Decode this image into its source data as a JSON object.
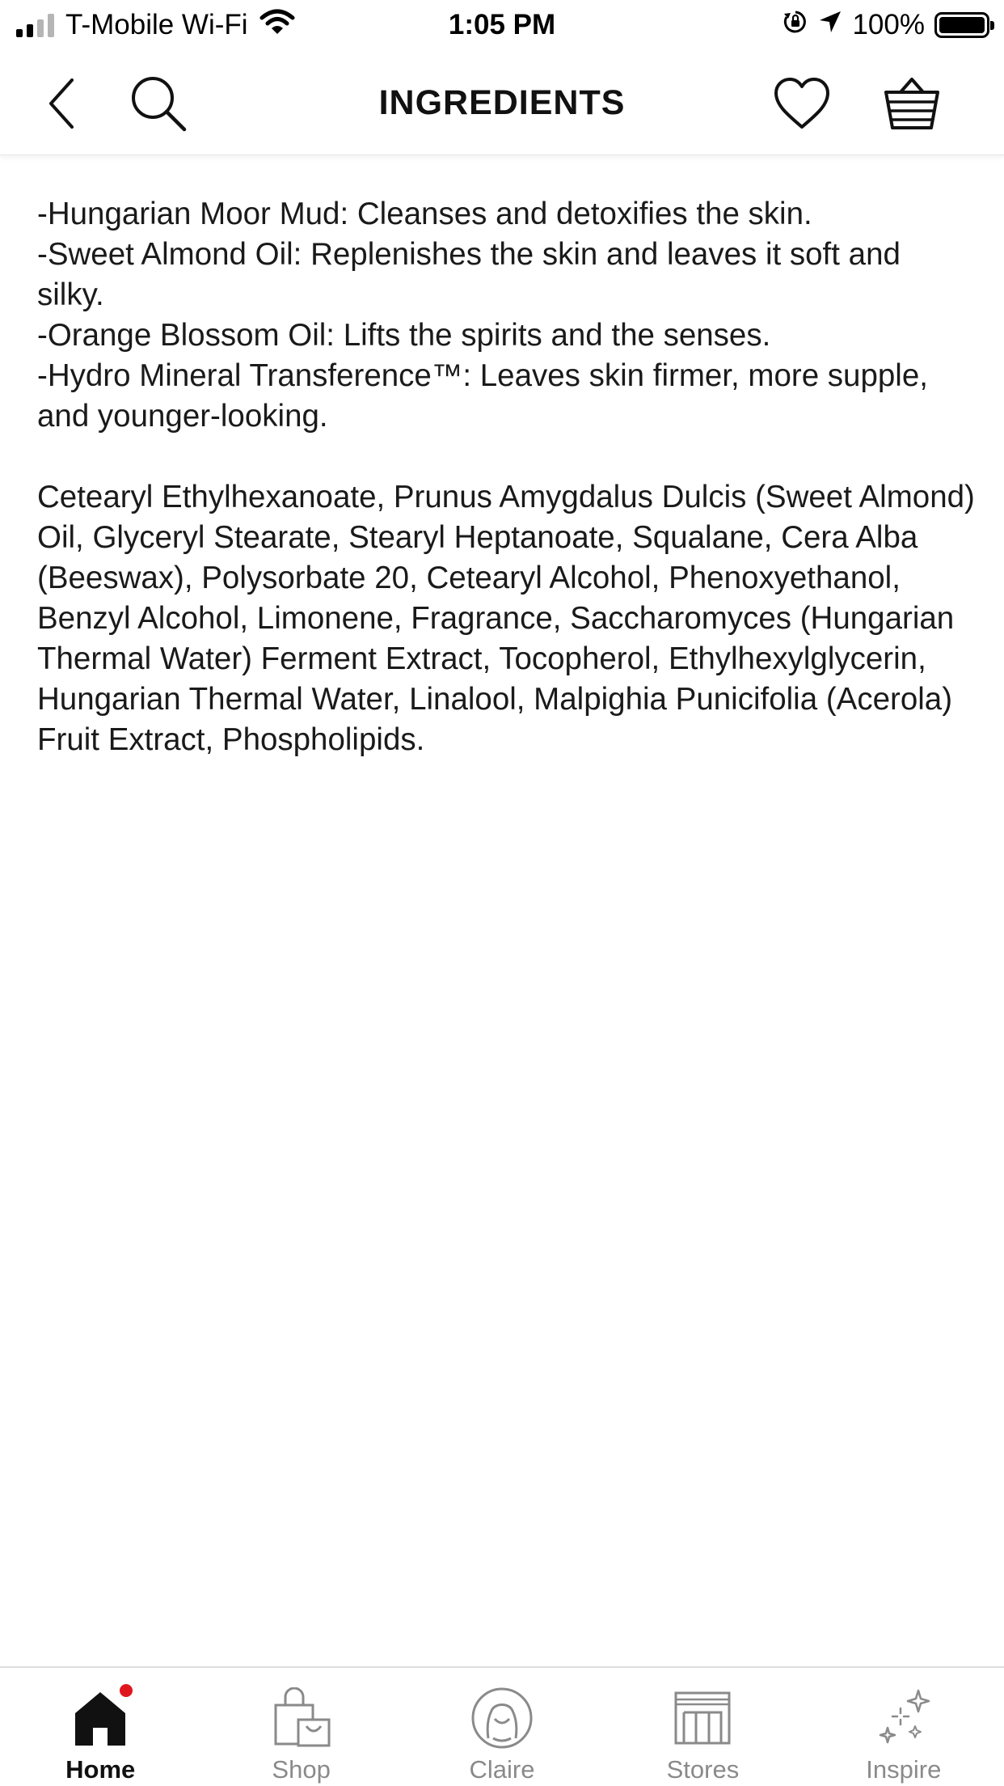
{
  "status_bar": {
    "carrier": "T-Mobile Wi-Fi",
    "time": "1:05 PM",
    "battery": "100%",
    "icons": [
      "signal-icon",
      "wifi-icon",
      "orientation-lock-icon",
      "location-arrow-icon",
      "battery-icon"
    ]
  },
  "header": {
    "title": "INGREDIENTS",
    "icons": [
      "back-chevron-icon",
      "search-icon",
      "heart-icon",
      "basket-icon"
    ]
  },
  "content": {
    "benefits": [
      "-Hungarian Moor Mud: Cleanses and detoxifies the skin.",
      "-Sweet Almond Oil: Replenishes the skin and leaves it soft and silky.",
      "-Orange Blossom Oil: Lifts the spirits and the senses.",
      "-Hydro Mineral Transference™: Leaves skin firmer, more supple, and younger-looking."
    ],
    "ingredient_list": "Cetearyl Ethylhexanoate, Prunus Amygdalus Dulcis (Sweet Almond) Oil, Glyceryl Stearate, Stearyl Heptanoate, Squalane, Cera Alba (Beeswax), Polysorbate 20, Cetearyl Alcohol, Phenoxyethanol, Benzyl Alcohol, Limonene, Fragrance, Saccharomyces (Hungarian Thermal Water) Ferment Extract, Tocopherol, Ethylhexylglycerin, Hungarian Thermal Water, Linalool, Malpighia Punicifolia (Acerola) Fruit Extract, Phospholipids."
  },
  "tab_bar": {
    "items": [
      {
        "label": "Home",
        "icon": "home-icon",
        "active": true,
        "has_badge": true
      },
      {
        "label": "Shop",
        "icon": "shopping-bag-icon",
        "active": false
      },
      {
        "label": "Claire",
        "icon": "claire-icon",
        "active": false
      },
      {
        "label": "Stores",
        "icon": "store-icon",
        "active": false
      },
      {
        "label": "Inspire",
        "icon": "sparkle-icon",
        "active": false
      }
    ]
  },
  "colors": {
    "badge": "#e0161e",
    "text": "#111111",
    "inactive_tab": "#8a8a8a"
  }
}
